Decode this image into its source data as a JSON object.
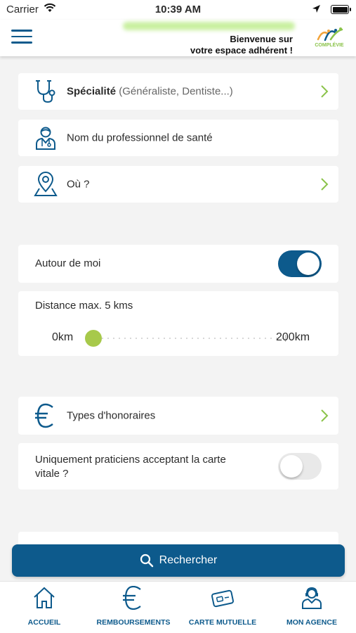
{
  "status_bar": {
    "carrier": "Carrier",
    "time": "10:39 AM"
  },
  "header": {
    "welcome_line1": "Bienvenue sur",
    "welcome_line2": "votre espace adhérent !",
    "logo_text": "COMPLÉVIE"
  },
  "search_fields": {
    "specialite_label": "Spécialité",
    "specialite_hint": "(Généraliste, Dentiste...)",
    "nom_label": "Nom du professionnel de santé",
    "ou_label": "Où ?"
  },
  "autour_de_moi": {
    "label": "Autour de moi",
    "enabled": true
  },
  "distance": {
    "label": "Distance max. 5 kms",
    "min_label": "0km",
    "max_label": "200km",
    "value_km": 5,
    "min_km": 0,
    "max_km": 200
  },
  "honoraires": {
    "label": "Types d'honoraires"
  },
  "carte_vitale": {
    "label_line1": "Uniquement praticiens acceptant la carte",
    "label_line2": "vitale ?",
    "enabled": false
  },
  "search_button": {
    "label": "Rechercher"
  },
  "bottom_nav": [
    {
      "label": "ACCUEIL",
      "icon": "home-icon"
    },
    {
      "label": "REMBOURSEMENTS",
      "icon": "euro-icon"
    },
    {
      "label": "CARTE MUTUELLE",
      "icon": "card-icon"
    },
    {
      "label": "MON AGENCE",
      "icon": "agent-icon"
    }
  ],
  "colors": {
    "primary": "#0d5a8c",
    "accent_green": "#a7c94b",
    "background": "#f3f3f3"
  }
}
